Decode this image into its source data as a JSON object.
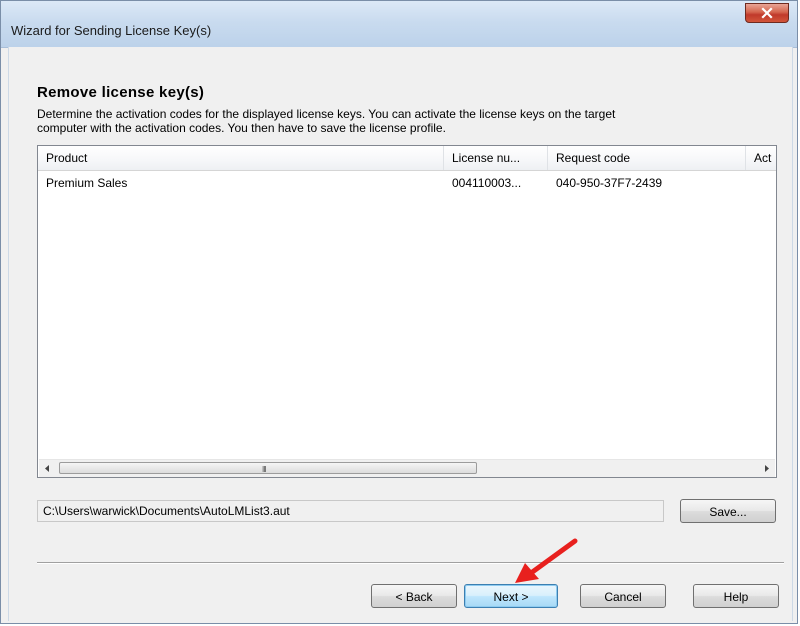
{
  "window": {
    "title": "Wizard for Sending License Key(s)",
    "close_glyph": "X"
  },
  "page": {
    "heading": "Remove license key(s)",
    "description_line1": "Determine the activation codes for the displayed license keys. You can activate the license keys on the target",
    "description_line2": "computer with the activation codes. You then have to save the license profile."
  },
  "table": {
    "columns": [
      "Product",
      "License nu...",
      "Request code",
      "Act"
    ],
    "rows": [
      [
        "Premium Sales",
        "004110003...",
        "040-950-37F7-2439",
        ""
      ]
    ],
    "scroll_grip": "III"
  },
  "file": {
    "path": "C:\\Users\\warwick\\Documents\\AutoLMList3.aut",
    "save_label": "Save..."
  },
  "footer": {
    "back_label": "< Back",
    "next_label": "Next >",
    "cancel_label": "Cancel",
    "help_label": "Help"
  },
  "annotation": {
    "arrow_color": "#e8201e",
    "arrow_icon": "red-arrow-icon"
  }
}
